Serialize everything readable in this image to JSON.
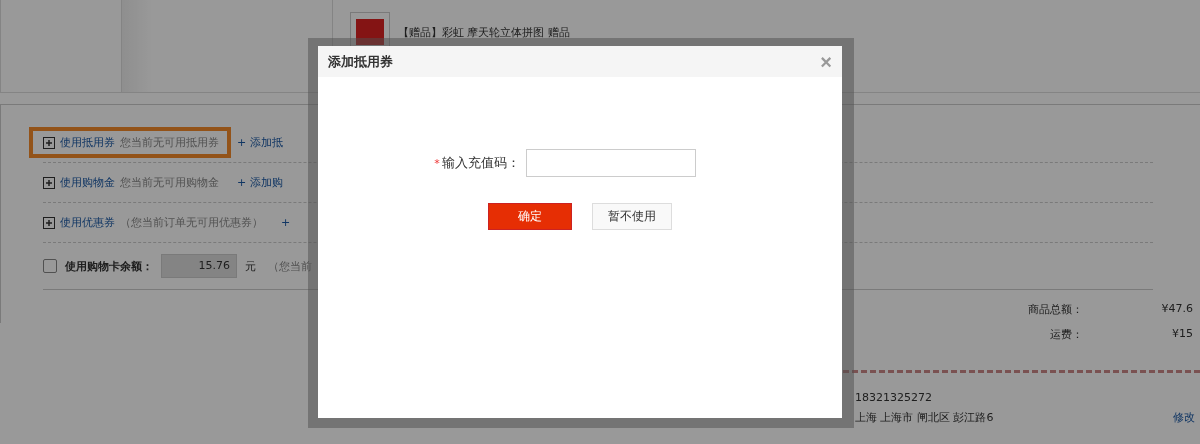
{
  "gift_item": {
    "text": "【赠品】彩虹 摩天轮立体拼图 赠品"
  },
  "options": [
    {
      "kind": "expand",
      "label": "使用抵用券",
      "note": "您当前无可用抵用券",
      "add_link": "+ 添加抵",
      "highlighted": true
    },
    {
      "kind": "expand",
      "label": "使用购物金",
      "note": "您当前无可用购物金",
      "add_link": "+ 添加购",
      "highlighted": false
    },
    {
      "kind": "expand",
      "label": "使用优惠券",
      "note": "（您当前订单无可用优惠券）",
      "add_link": "+",
      "highlighted": false
    },
    {
      "kind": "balance",
      "label": "使用购物卡余额：",
      "checked": false,
      "value": "15.76",
      "unit": "元",
      "note": "（您当前"
    }
  ],
  "summary": [
    {
      "label": "商品总额：",
      "value": "¥47.6"
    },
    {
      "label": "运费：",
      "value": "¥15"
    }
  ],
  "address": {
    "phone": "18321325272",
    "line": "上海 上海市 闸北区 彭江路6",
    "edit_link": "修改"
  },
  "dialog": {
    "title": "添加抵用券",
    "close": "×",
    "field_label": "输入充值码：",
    "required_mark": "*",
    "confirm": "确定",
    "cancel": "暂不使用"
  }
}
